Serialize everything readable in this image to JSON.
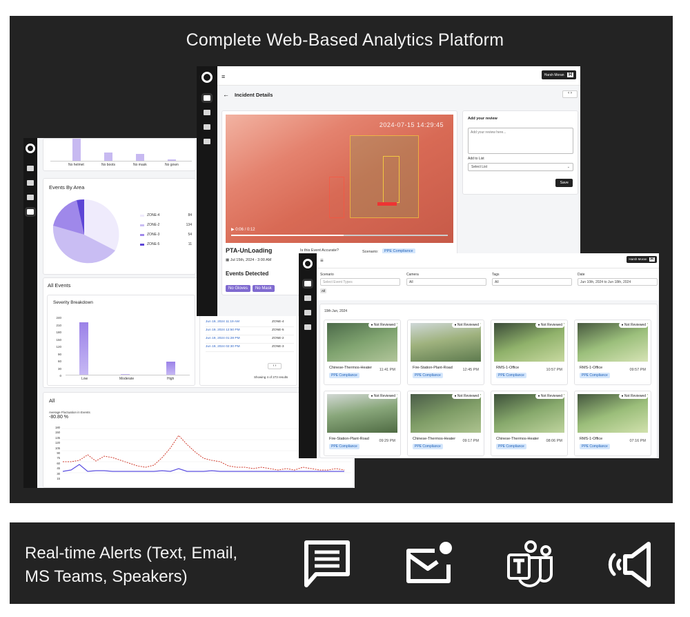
{
  "headline": "Complete Web-Based Analytics Platform",
  "alerts_text": [
    "Real-time Alerts (Text, Email,",
    "MS Teams, Speakers)"
  ],
  "alert_icons": [
    "message-icon",
    "email-icon",
    "teams-icon",
    "speaker-icon"
  ],
  "colors": {
    "panel": "#232323",
    "accent": "#7f6ad0",
    "line_blue": "#5b4fe0",
    "line_red": "#d03a2b"
  },
  "dashboard": {
    "top_bar_labels": [
      "No helmet",
      "No boots",
      "No mask",
      "No gown"
    ],
    "events_by_area": {
      "title": "Events By Area",
      "legend": [
        {
          "label": "ZONE-4",
          "value": "84"
        },
        {
          "label": "ZONE-2",
          "value": "134"
        },
        {
          "label": "ZONE-3",
          "value": "54"
        },
        {
          "label": "ZONE-5",
          "value": "11"
        }
      ]
    },
    "all_events_title": "All Events",
    "severity": {
      "title": "Severity Breakdown",
      "yticks": [
        "240",
        "210",
        "180",
        "150",
        "120",
        "90",
        "60",
        "30",
        "0"
      ],
      "categories": [
        "Low",
        "Moderate",
        "High"
      ]
    },
    "events_table": {
      "rows": [
        {
          "date": "Jun 19, 2024 11:19 AM",
          "zone": "ZONE-4"
        },
        {
          "date": "Jun 19, 2024 12:50 PM",
          "zone": "ZONE-5"
        },
        {
          "date": "Jun 19, 2024 01:28 PM",
          "zone": "ZONE-2"
        },
        {
          "date": "Jun 19, 2024 02:30 PM",
          "zone": "ZONE-3"
        }
      ],
      "footer": "Showing 4 of 273 results"
    },
    "all_chart": {
      "title": "All",
      "subtitle": "Average Fluctuation in Events",
      "value": "-80.80 %",
      "yticks": [
        "180",
        "150",
        "135",
        "120",
        "105",
        "90",
        "75",
        "60",
        "45",
        "30",
        "15"
      ]
    }
  },
  "incident": {
    "title": "Incident Details",
    "user": "Harsh Moran",
    "user_initial": "H",
    "video_timestamp": "2024-07-15 14:29:45",
    "video_time": "0:06 / 0:12",
    "event_name": "PTA-UnLoading",
    "event_date": "Jul 15th, 2024 - 3:00 AM",
    "accuracy_question": "Is this Event Accurate?",
    "scenario_label": "Scenario:",
    "scenario_value": "PPE Compliance",
    "events_detected_title": "Events Detected",
    "detected": [
      "No Gloves",
      "No Mask"
    ],
    "review_title": "Add your review",
    "review_placeholder": "Add your review here...",
    "list_label": "Add to List",
    "list_placeholder": "Select List",
    "save_label": "Save"
  },
  "grid": {
    "user": "Harsh Moran",
    "user_initial": "H",
    "filters": [
      {
        "label": "Scenario",
        "value": "Select Event Types"
      },
      {
        "label": "Camera",
        "value": "All"
      },
      {
        "label": "Tags",
        "value": "All"
      },
      {
        "label": "Date",
        "value": "Jun 10th, 2024 to Jun 18th, 2024"
      }
    ],
    "all_chip": "All",
    "date_header": "19th Jun, 2024",
    "status_label": "Not Reviewed",
    "tiles": [
      {
        "name": "Chinese-Thermos-Heater",
        "time": "11:41 PM",
        "chip": "PPE Compliance"
      },
      {
        "name": "Fire-Station-Plant-Road",
        "time": "12:45 PM",
        "chip": "PPE Compliance"
      },
      {
        "name": "RMS-1-Office",
        "time": "10:57 PM",
        "chip": "PPE Compliance"
      },
      {
        "name": "RMS-1-Office",
        "time": "09:57 PM",
        "chip": "PPE Compliance"
      },
      {
        "name": "Fire-Station-Plant-Road",
        "time": "09:29 PM",
        "chip": "PPE Compliance"
      },
      {
        "name": "Chinese-Thermos-Heater",
        "time": "09:17 PM",
        "chip": "PPE Compliance"
      },
      {
        "name": "Chinese-Thermos-Heater",
        "time": "08:06 PM",
        "chip": "PPE Compliance"
      },
      {
        "name": "RMS-1-Office",
        "time": "07:16 PM",
        "chip": "PPE Compliance"
      }
    ]
  }
}
